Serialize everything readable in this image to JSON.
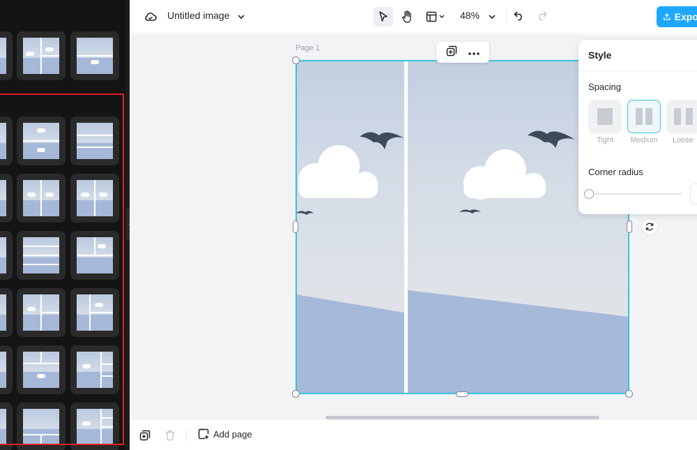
{
  "topbar": {
    "title": "Untitled image",
    "zoom": "48%",
    "export_label": "Export",
    "icons": [
      "cloud-icon",
      "chevron-down-icon",
      "select-pointer-icon",
      "hand-icon",
      "layout-icon",
      "undo-icon",
      "redo-icon",
      "export-icon"
    ]
  },
  "canvas": {
    "page_label": "Page 1"
  },
  "style_panel": {
    "title": "Style",
    "spacing_label": "Spacing",
    "spacing_options": [
      "Tight",
      "Medium",
      "Loose"
    ],
    "selected_spacing": "Medium",
    "corner_radius_label": "Corner radius",
    "corner_radius_value": 0
  },
  "bottombar": {
    "add_page_label": "Add page"
  },
  "colors": {
    "accent": "#3ac2dc",
    "export": "#1ea7ff",
    "highlight": "#e02020",
    "sidebar": "#141414"
  }
}
